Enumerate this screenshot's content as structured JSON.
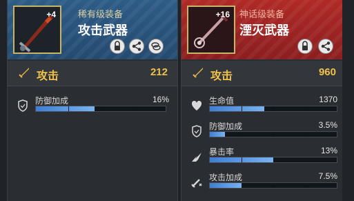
{
  "left_card": {
    "level": "+4",
    "rarity": "稀有级装备",
    "name": "攻击武器",
    "attack_label": "攻击",
    "attack_value": "212",
    "stats": [
      {
        "label": "防御加成",
        "value": "16%",
        "fill": 0.45
      }
    ]
  },
  "right_card": {
    "level": "+16",
    "rarity": "神话级装备",
    "name": "湮灭武器",
    "attack_label": "攻击",
    "attack_value": "960",
    "stats": [
      {
        "label": "生命值",
        "value": "1370",
        "fill": 0.43
      },
      {
        "label": "防御加成",
        "value": "3.5%",
        "fill": 0.12
      },
      {
        "label": "暴击率",
        "value": "13%",
        "fill": 0.5
      },
      {
        "label": "攻击加成",
        "value": "7.5%",
        "fill": 0.25
      }
    ]
  },
  "colors": {
    "rare_header": "#2e5c86",
    "mythic_header": "#b02a26",
    "attack_gold": "#f0c24a",
    "bar_blue": "#3e7ed4"
  },
  "icons": {
    "left_buttons": [
      "lock-icon",
      "share-icon",
      "coins-icon"
    ],
    "right_buttons": [
      "lock-icon",
      "share-icon"
    ],
    "stat_icons": [
      "sword-icon",
      "heart-icon",
      "shield-icon",
      "crit-icon",
      "attack-boost-icon"
    ]
  }
}
